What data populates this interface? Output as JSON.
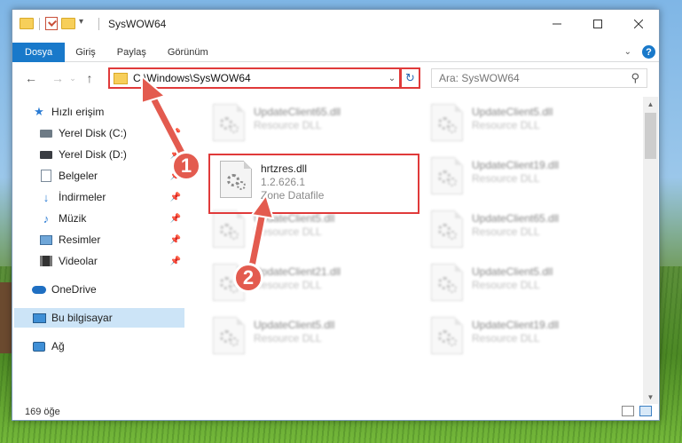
{
  "window": {
    "title": "SysWOW64"
  },
  "ribbon": {
    "tabs": [
      "Dosya",
      "Giriş",
      "Paylaş",
      "Görünüm"
    ],
    "help": "?"
  },
  "nav": {
    "path": "C:\\Windows\\SysWOW64",
    "search_placeholder": "Ara: SysWOW64"
  },
  "sidebar": {
    "items": [
      {
        "label": "Hızlı erişim",
        "icon": "star-icon"
      },
      {
        "label": "Yerel Disk (C:)",
        "icon": "drive-icon"
      },
      {
        "label": "Yerel Disk (D:)",
        "icon": "drive-icon"
      },
      {
        "label": "Belgeler",
        "icon": "documents-icon"
      },
      {
        "label": "İndirmeler",
        "icon": "download-icon"
      },
      {
        "label": "Müzik",
        "icon": "music-icon"
      },
      {
        "label": "Resimler",
        "icon": "pictures-icon"
      },
      {
        "label": "Videolar",
        "icon": "videos-icon"
      },
      {
        "label": "OneDrive",
        "icon": "cloud-icon"
      },
      {
        "label": "Bu bilgisayar",
        "icon": "computer-icon"
      },
      {
        "label": "Ağ",
        "icon": "network-icon"
      }
    ]
  },
  "files": {
    "highlighted": {
      "name": "hrtzres.dll",
      "version": "1.2.626.1",
      "type": "Zone Datafile"
    },
    "blurred": [
      {
        "name": "UpdateClient65.dll",
        "type": "Resource DLL"
      },
      {
        "name": "UpdateClient5.dll",
        "type": "Resource DLL"
      },
      {
        "name": "UpdateClient19.dll",
        "type": "Resource DLL"
      },
      {
        "name": "UpdateClient5.dll",
        "type": "Resource DLL"
      },
      {
        "name": "UpdateClient65.dll",
        "type": "Resource DLL"
      },
      {
        "name": "UpdateClient21.dll",
        "type": "Resource DLL"
      },
      {
        "name": "UpdateClient5.dll",
        "type": "Resource DLL"
      },
      {
        "name": "UpdateClient5.dll",
        "type": "Resource DLL"
      },
      {
        "name": "UpdateClient19.dll",
        "type": "Resource DLL"
      }
    ]
  },
  "status": {
    "count": "169 öğe"
  },
  "callouts": {
    "step1": "1",
    "step2": "2"
  },
  "colors": {
    "accent": "#1979ca",
    "highlight": "#e03a3a",
    "badge": "#e35b4f"
  }
}
